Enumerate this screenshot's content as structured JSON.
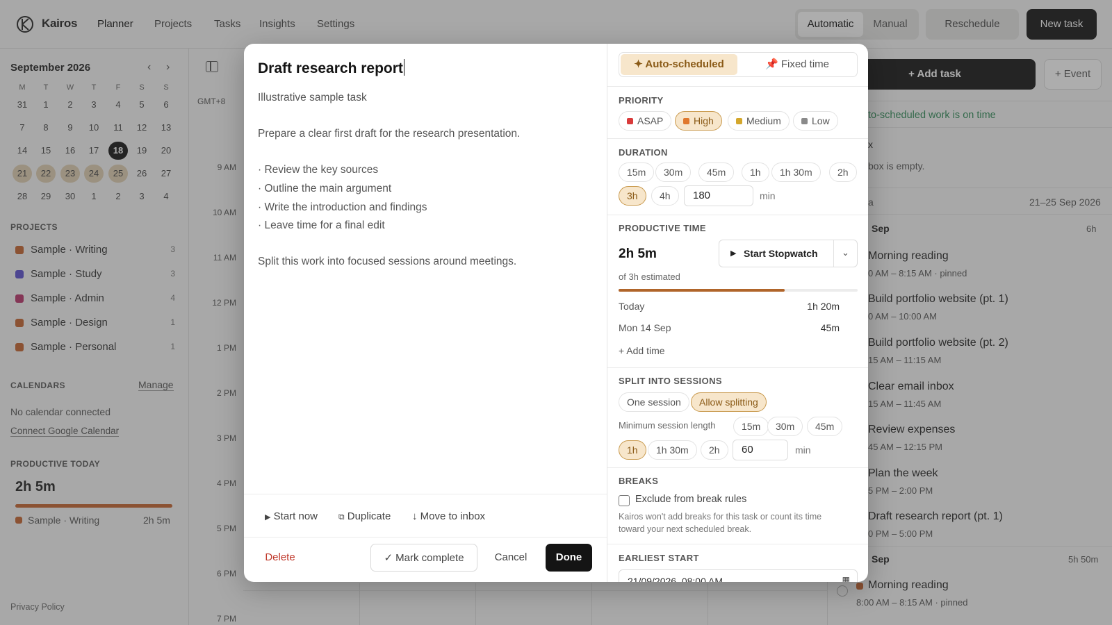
{
  "app": {
    "brand": "Kairos",
    "nav": [
      "Planner",
      "Projects",
      "Tasks",
      "Insights",
      "Settings"
    ],
    "mode_automatic": "Automatic",
    "mode_manual": "Manual",
    "reschedule": "Reschedule",
    "new_task": "New task"
  },
  "sidebar": {
    "month": "September 2026",
    "prev": "‹",
    "next": "›",
    "weekdays": [
      "M",
      "T",
      "W",
      "T",
      "F",
      "S",
      "S"
    ],
    "weeks": [
      [
        "31",
        "1",
        "2",
        "3",
        "4",
        "5",
        "6"
      ],
      [
        "7",
        "8",
        "9",
        "10",
        "11",
        "12",
        "13"
      ],
      [
        "14",
        "15",
        "16",
        "17",
        "18",
        "19",
        "20"
      ],
      [
        "21",
        "22",
        "23",
        "24",
        "25",
        "26",
        "27"
      ],
      [
        "28",
        "29",
        "30",
        "1",
        "2",
        "3",
        "4"
      ]
    ],
    "projects_label": "PROJECTS",
    "projects": [
      {
        "name": "Sample · Writing",
        "count": "3",
        "color": "#c4622d"
      },
      {
        "name": "Sample · Study",
        "count": "3",
        "color": "#5a4fcf"
      },
      {
        "name": "Sample · Admin",
        "count": "4",
        "color": "#b8336a"
      },
      {
        "name": "Sample · Design",
        "count": "1",
        "color": "#c4622d"
      },
      {
        "name": "Sample · Personal",
        "count": "1",
        "color": "#c4622d"
      }
    ],
    "calendars_label": "CALENDARS",
    "manage": "Manage",
    "no_calendar": "No calendar connected",
    "connect_google": "Connect Google Calendar",
    "productive_today_label": "PRODUCTIVE TODAY",
    "productive_today_value": "2h 5m",
    "productive_today_fraction": 1.0,
    "productive_row_name": "Sample · Writing",
    "productive_row_value": "2h 5m",
    "privacy": "Privacy Policy"
  },
  "grid": {
    "timezone": "GMT+8",
    "hours": [
      "9 AM",
      "10 AM",
      "11 AM",
      "12 PM",
      "1 PM",
      "2 PM",
      "3 PM",
      "4 PM",
      "5 PM",
      "6 PM",
      "7 PM"
    ]
  },
  "right_panel": {
    "add_task": "+ Add task",
    "event": "+ Event",
    "status": "to-scheduled work is on time",
    "inbox_title": "x",
    "inbox_empty": "box is empty.",
    "week_label": "a",
    "week_range": "21–25 Sep 2026",
    "day1_label": "Sep",
    "day1_total": "6h",
    "items": [
      {
        "title": "Morning reading",
        "time": "0 AM – 8:15 AM · pinned"
      },
      {
        "title": "Build portfolio website (pt. 1)",
        "time": "0 AM – 10:00 AM"
      },
      {
        "title": "Build portfolio website (pt. 2)",
        "time": "15 AM – 11:15 AM"
      },
      {
        "title": "Clear email inbox",
        "time": "15 AM – 11:45 AM"
      },
      {
        "title": "Review expenses",
        "time": "45 AM – 12:15 PM"
      },
      {
        "title": "Plan the week",
        "time": "5 PM – 2:00 PM"
      },
      {
        "title": "Draft research report (pt. 1)",
        "time": "0 PM – 5:00 PM"
      }
    ],
    "day2_label": "Sep",
    "day2_total": "5h 50m",
    "day2_item_title": "Morning reading",
    "day2_item_time": "8:00 AM – 8:15 AM · pinned"
  },
  "modal": {
    "title": "Draft research report",
    "subtitle": "Illustrative sample task",
    "body": [
      "Prepare a clear first draft for the research presentation.",
      "· Review the key sources",
      "· Outline the main argument",
      "· Write the introduction and findings",
      "· Leave time for a final edit",
      "Split this work into focused sessions around meetings."
    ],
    "start_now": "Start now",
    "duplicate": "Duplicate",
    "move_to_inbox": "Move to inbox",
    "delete": "Delete",
    "mark_complete": "✓ Mark complete",
    "cancel": "Cancel",
    "done": "Done",
    "tab_auto": "✦ Auto-scheduled",
    "tab_fixed": "Fixed time",
    "priority_label": "PRIORITY",
    "priorities": [
      {
        "label": "ASAP",
        "color": "#d93a3a"
      },
      {
        "label": "High",
        "color": "#e0782c"
      },
      {
        "label": "Medium",
        "color": "#d4a72c"
      },
      {
        "label": "Low",
        "color": "#8a8a8a"
      }
    ],
    "duration_label": "DURATION",
    "durations": [
      "15m",
      "30m",
      "45m",
      "1h",
      "1h 30m",
      "2h",
      "3h",
      "4h"
    ],
    "duration_value": "180",
    "unit_min": "min",
    "productive_label": "PRODUCTIVE TIME",
    "productive_value": "2h 5m",
    "estimated": "of 3h estimated",
    "productive_fraction": 0.694,
    "stopwatch": "Start Stopwatch",
    "log": [
      {
        "label": "Today",
        "value": "1h 20m"
      },
      {
        "label": "Mon 14 Sep",
        "value": "45m"
      }
    ],
    "add_time": "+ Add time",
    "split_label": "SPLIT INTO SESSIONS",
    "one_session": "One session",
    "allow_splitting": "Allow splitting",
    "min_session_label": "Minimum session length",
    "sessions": [
      "15m",
      "30m",
      "45m",
      "1h",
      "1h 30m",
      "2h"
    ],
    "session_value": "60",
    "breaks_label": "BREAKS",
    "exclude_breaks": "Exclude from break rules",
    "breaks_note_1": "Kairos won't add breaks for this task or count its time",
    "breaks_note_2": "toward your next scheduled break.",
    "earliest_label": "EARLIEST START",
    "earliest_value": "21/09/2026, 08:00 AM"
  }
}
